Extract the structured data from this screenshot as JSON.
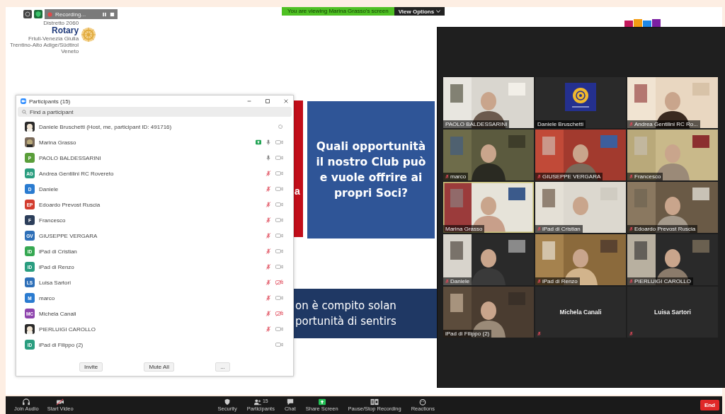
{
  "top_bar": {
    "recording": "Recording...",
    "banner": "You are viewing Marina Grasso's screen",
    "view_options": "View Options"
  },
  "slide": {
    "logo": {
      "district": "Distretto 2060",
      "name": "Rotary",
      "regions": [
        "Friuli-Venezia Giulia",
        "Trentino-Alto Adige/Südtirol",
        "Veneto"
      ]
    },
    "side_letter": "a",
    "question": "Quali opportunità il nostro Club può e vuole offrire ai propri Soci?",
    "banner_lines": [
      "on è compito solan",
      "portunità di sentirs"
    ]
  },
  "participants_panel": {
    "title": "Participants (15)",
    "search": {
      "placeholder": "Find a participant"
    },
    "rows": [
      {
        "name": "Daniele Bruschetti (Host, me, participant ID: 491716)",
        "host": true,
        "sharing": false
      },
      {
        "name": "Marina Grasso",
        "host": false,
        "sharing": true,
        "audio": {
          "muted": false
        },
        "video": {
          "off": false
        }
      },
      {
        "name": "PAOLO BALDESSARINI",
        "avatar": {
          "kind": "initials",
          "initials": "P",
          "color": "#5a9e3a"
        },
        "host": false,
        "sharing": false,
        "audio": {
          "muted": false
        },
        "video": {
          "off": false
        }
      },
      {
        "name": "Andrea Gentilini RC Rovereto",
        "avatar": {
          "kind": "initials",
          "initials": "AG",
          "color": "#2a9d7f"
        },
        "host": false,
        "sharing": false,
        "audio": {
          "muted": true
        },
        "video": {
          "off": false
        }
      },
      {
        "name": "Daniele",
        "avatar": {
          "kind": "initials",
          "initials": "D",
          "color": "#2a7bd0"
        },
        "host": false,
        "sharing": false,
        "audio": {
          "muted": true
        },
        "video": {
          "off": false
        }
      },
      {
        "name": "Edoardo Prevost Ruscia",
        "avatar": {
          "kind": "initials",
          "initials": "EP",
          "color": "#d33c2e"
        },
        "host": false,
        "sharing": false,
        "audio": {
          "muted": true
        },
        "video": {
          "off": false
        }
      },
      {
        "name": "Francesco",
        "avatar": {
          "kind": "initials",
          "initials": "F",
          "color": "#2c3e5a"
        },
        "host": false,
        "sharing": false,
        "audio": {
          "muted": true
        },
        "video": {
          "off": false
        }
      },
      {
        "name": "GIUSEPPE VERGARA",
        "avatar": {
          "kind": "initials",
          "initials": "GV",
          "color": "#2d6fb8"
        },
        "host": false,
        "sharing": false,
        "audio": {
          "muted": true
        },
        "video": {
          "off": false
        }
      },
      {
        "name": "iPad di Cristian",
        "avatar": {
          "kind": "initials",
          "initials": "ID",
          "color": "#36a852"
        },
        "host": false,
        "sharing": false,
        "audio": {
          "muted": true
        },
        "video": {
          "off": false
        }
      },
      {
        "name": "iPad di Renzo",
        "avatar": {
          "kind": "initials",
          "initials": "ID",
          "color": "#2a9d7f"
        },
        "host": false,
        "sharing": false,
        "audio": {
          "muted": true
        },
        "video": {
          "off": false
        }
      },
      {
        "name": "Luisa Sartori",
        "avatar": {
          "kind": "initials",
          "initials": "LS",
          "color": "#2d6fb8"
        },
        "host": false,
        "sharing": false,
        "audio": {
          "muted": true
        },
        "video": {
          "off": true
        }
      },
      {
        "name": "marco",
        "avatar": {
          "kind": "initials",
          "initials": "M",
          "color": "#2a7bd0"
        },
        "host": false,
        "sharing": false,
        "audio": {
          "muted": true
        },
        "video": {
          "off": false
        }
      },
      {
        "name": "Michela Canali",
        "avatar": {
          "kind": "initials",
          "initials": "MC",
          "color": "#8e44ad"
        },
        "host": false,
        "sharing": false,
        "audio": {
          "muted": true
        },
        "video": {
          "off": true
        }
      },
      {
        "name": "PIERLUIGI CAROLLO",
        "host": false,
        "sharing": false,
        "audio": {
          "muted": true
        },
        "video": {
          "off": false
        }
      },
      {
        "name": "iPad di Filippo (2)",
        "avatar": {
          "kind": "initials",
          "initials": "ID",
          "color": "#2a9d7f"
        },
        "host": false,
        "sharing": false,
        "video": {
          "off": false
        }
      }
    ],
    "buttons": [
      "Invite",
      "Mute All",
      "..."
    ]
  },
  "gallery": {
    "tiles": [
      {
        "name": "PAOLO BALDESSARINI",
        "kind": "video",
        "muted": false,
        "speaking": false
      },
      {
        "name": "Daniele Bruschetti",
        "kind": "logo",
        "muted": false,
        "speaking": false
      },
      {
        "name": "Andrea Gentilini RC Ro...",
        "kind": "video",
        "muted": true,
        "speaking": false
      },
      {
        "name": "marco",
        "kind": "video",
        "muted": true,
        "speaking": false
      },
      {
        "name": "GIUSEPPE VERGARA",
        "kind": "video",
        "muted": true,
        "speaking": false
      },
      {
        "name": "Francesco",
        "kind": "video",
        "muted": true,
        "speaking": false
      },
      {
        "name": "Marina Grasso",
        "kind": "video",
        "muted": false,
        "speaking": true
      },
      {
        "name": "iPad di Cristian",
        "kind": "video",
        "muted": true,
        "speaking": false
      },
      {
        "name": "Edoardo Prevost Ruscia",
        "kind": "video",
        "muted": true,
        "speaking": false
      },
      {
        "name": "Daniele",
        "kind": "video",
        "muted": true,
        "speaking": false
      },
      {
        "name": "iPad di Renzo",
        "kind": "video",
        "muted": true,
        "speaking": false
      },
      {
        "name": "PIERLUIGI CAROLLO",
        "kind": "video",
        "muted": true,
        "speaking": false
      },
      {
        "name": "iPad di Filippo (2)",
        "kind": "video",
        "muted": false,
        "speaking": false
      },
      {
        "name": "Michela Canali",
        "kind": "name",
        "muted": true,
        "speaking": false
      },
      {
        "name": "Luisa Sartori",
        "kind": "name",
        "muted": true,
        "speaking": false
      }
    ]
  },
  "toolbar": {
    "left": [
      {
        "kind": "audio",
        "label": "Join Audio"
      },
      {
        "kind": "video",
        "label": "Start Video"
      }
    ],
    "center": [
      {
        "kind": "security",
        "label": "Security"
      },
      {
        "kind": "participants",
        "label": "Participants",
        "count": "15"
      },
      {
        "kind": "chat",
        "label": "Chat"
      },
      {
        "kind": "share",
        "label": "Share Screen"
      },
      {
        "kind": "recording",
        "label": "Pause/Stop Recording"
      },
      {
        "kind": "reactions",
        "label": "Reactions"
      }
    ],
    "end": "End"
  }
}
